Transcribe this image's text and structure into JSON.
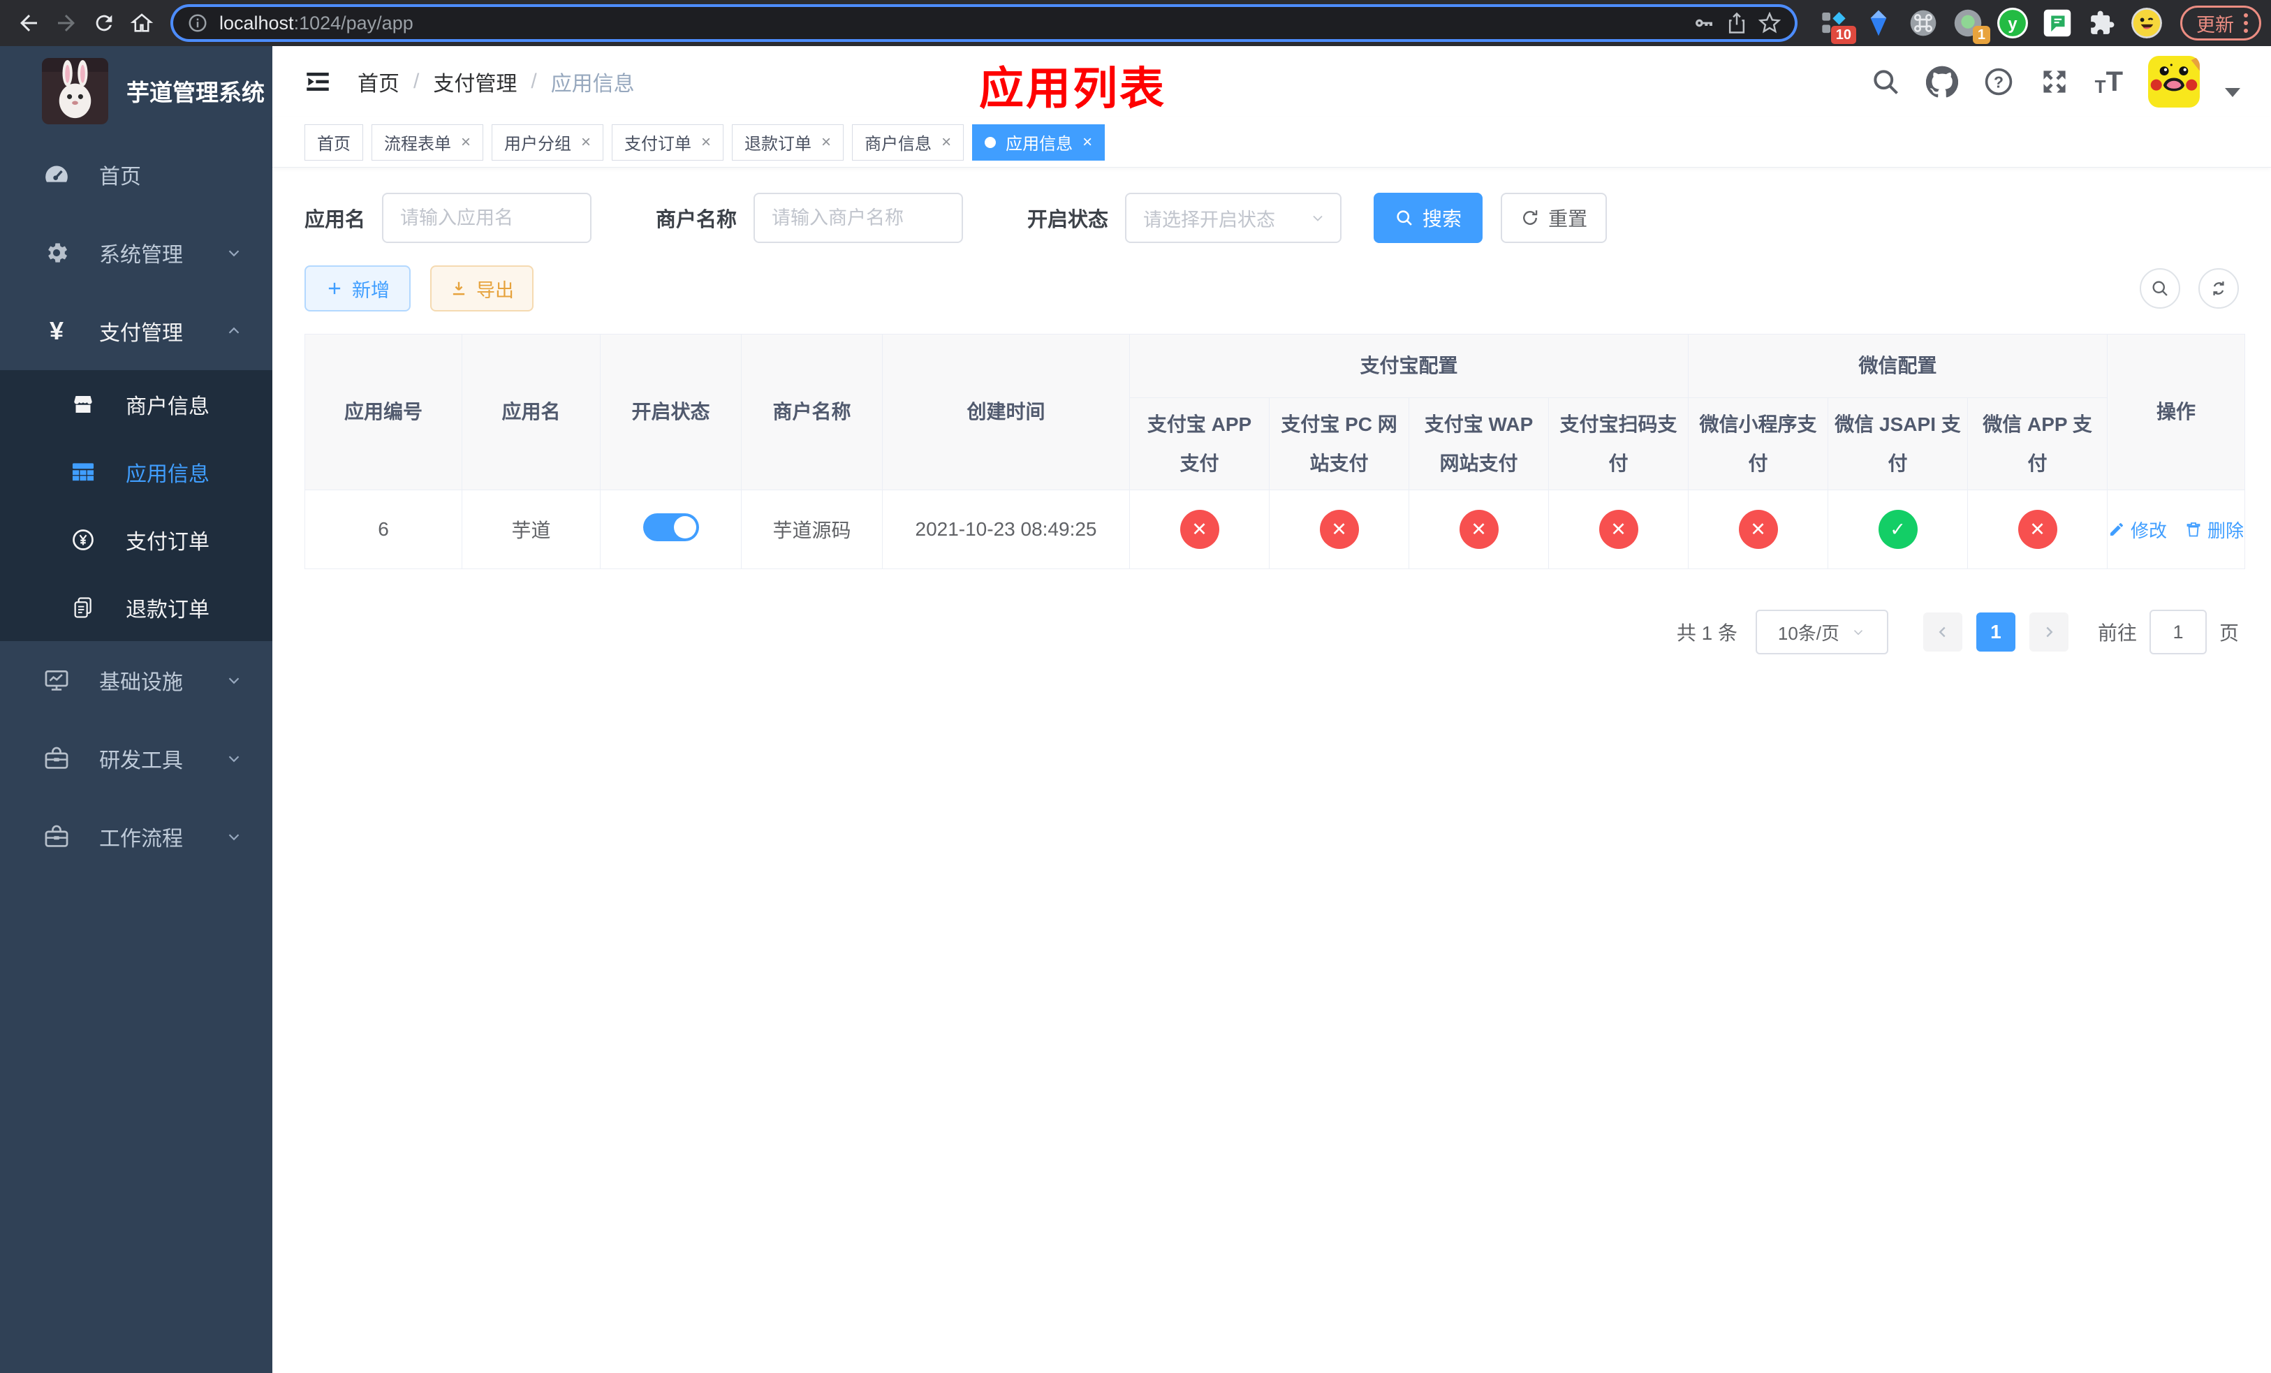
{
  "browser": {
    "url_host": "localhost",
    "url_path": ":1024/pay/app",
    "update_label": "更新",
    "extensions": {
      "badge_ten": "10",
      "badge_one": "1",
      "y_letter": "y"
    }
  },
  "sidebar": {
    "title": "芋道管理系统",
    "items": [
      {
        "icon": "dashboard-icon",
        "label": "首页"
      },
      {
        "icon": "gear-icon",
        "label": "系统管理",
        "expand": "down"
      },
      {
        "icon": "yen-icon",
        "label": "支付管理",
        "expand": "up",
        "active": true
      }
    ],
    "submenu": [
      {
        "icon": "store-icon",
        "label": "商户信息"
      },
      {
        "icon": "grid-icon",
        "label": "应用信息",
        "active": true
      },
      {
        "icon": "coin-icon",
        "label": "支付订单"
      },
      {
        "icon": "refund-doc-icon",
        "label": "退款订单"
      }
    ],
    "items_after": [
      {
        "icon": "monitor-icon",
        "label": "基础设施",
        "expand": "down"
      },
      {
        "icon": "toolbox-icon",
        "label": "研发工具",
        "expand": "down"
      },
      {
        "icon": "workflow-icon",
        "label": "工作流程",
        "expand": "down"
      }
    ],
    "yen_glyph": "¥"
  },
  "header": {
    "breadcrumb": [
      "首页",
      "支付管理",
      "应用信息"
    ],
    "separator": "/",
    "overlay_title": "应用列表"
  },
  "tags": [
    {
      "label": "首页",
      "closable": false
    },
    {
      "label": "流程表单",
      "closable": true
    },
    {
      "label": "用户分组",
      "closable": true
    },
    {
      "label": "支付订单",
      "closable": true
    },
    {
      "label": "退款订单",
      "closable": true
    },
    {
      "label": "商户信息",
      "closable": true
    },
    {
      "label": "应用信息",
      "closable": true,
      "active": true
    }
  ],
  "search": {
    "app_name_label": "应用名",
    "app_name_placeholder": "请输入应用名",
    "merchant_label": "商户名称",
    "merchant_placeholder": "请输入商户名称",
    "status_label": "开启状态",
    "status_placeholder": "请选择开启状态",
    "search_button": "搜索",
    "reset_button": "重置"
  },
  "toolbar": {
    "add_label": "新增",
    "export_label": "导出"
  },
  "table": {
    "simple_columns": [
      "应用编号",
      "应用名",
      "开启状态",
      "商户名称",
      "创建时间"
    ],
    "groups": [
      {
        "label": "支付宝配置",
        "children": [
          "支付宝 APP 支付",
          "支付宝 PC 网站支付",
          "支付宝 WAP 网站支付",
          "支付宝扫码支付"
        ]
      },
      {
        "label": "微信配置",
        "children": [
          "微信小程序支付",
          "微信 JSAPI 支付",
          "微信 APP 支付"
        ]
      }
    ],
    "op_column": "操作",
    "row": {
      "id": "6",
      "name": "芋道",
      "enabled": true,
      "merchant": "芋道源码",
      "created": "2021-10-23 08:49:25",
      "statuses": [
        {
          "state": "no",
          "glyph": "✕"
        },
        {
          "state": "no",
          "glyph": "✕"
        },
        {
          "state": "no",
          "glyph": "✕"
        },
        {
          "state": "no",
          "glyph": "✕"
        },
        {
          "state": "no",
          "glyph": "✕"
        },
        {
          "state": "yes",
          "glyph": "✓"
        },
        {
          "state": "no",
          "glyph": "✕"
        }
      ],
      "ops": [
        {
          "label": "修改"
        },
        {
          "label": "删除"
        }
      ]
    }
  },
  "pagination": {
    "total": "共 1 条",
    "page_size": "10条/页",
    "page": "1",
    "goto_label": "前往",
    "goto_value": "1",
    "page_unit": "页"
  },
  "colors": {
    "accent": "#409eff",
    "success": "#13ce66",
    "danger": "#f56c6c",
    "warning": "#e6a23c",
    "sidebar_bg": "#304156",
    "submenu_bg": "#1f2d3d",
    "overlay_title_red": "#fe0000"
  }
}
